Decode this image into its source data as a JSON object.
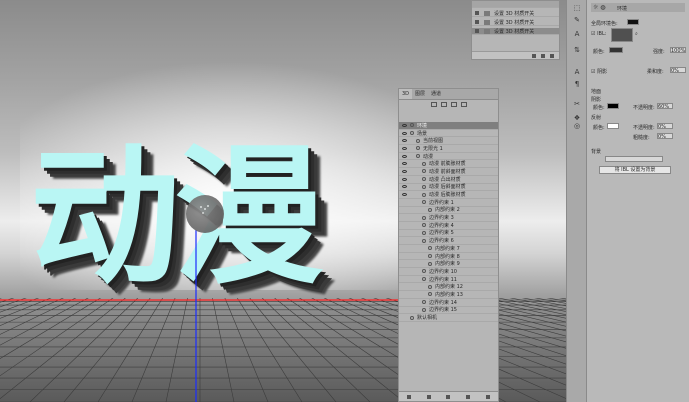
{
  "canvas": {
    "big_text": "动漫",
    "colors": {
      "text": "#b9f6f4",
      "extrusion": "#2e2e2e",
      "red_axis": "#ff2020",
      "blue_axis": "#1a2cff"
    }
  },
  "history_panel": {
    "items": [
      {
        "label": "设置 3D 材质开关",
        "selected": false
      },
      {
        "label": "设置 3D 材质开关",
        "selected": false
      },
      {
        "label": "设置 3D 材质开关",
        "selected": true
      }
    ]
  },
  "layers_panel": {
    "tabs": [
      "3D",
      "图层",
      "通道"
    ],
    "active_tab": "3D",
    "rows": [
      {
        "label": "环境",
        "indent": 0,
        "eye": true,
        "highlight": true
      },
      {
        "label": "场景",
        "indent": 0,
        "eye": true
      },
      {
        "label": "当前视图",
        "indent": 1,
        "eye": true
      },
      {
        "label": "无限光 1",
        "indent": 1,
        "eye": true
      },
      {
        "label": "动漫",
        "indent": 1,
        "eye": true
      },
      {
        "label": "动漫 前膨胀材质",
        "indent": 2,
        "eye": true
      },
      {
        "label": "动漫 前斜面材质",
        "indent": 2,
        "eye": true
      },
      {
        "label": "动漫 凸出材质",
        "indent": 2,
        "eye": true
      },
      {
        "label": "动漫 后斜面材质",
        "indent": 2,
        "eye": true
      },
      {
        "label": "动漫 后膨胀材质",
        "indent": 2,
        "eye": true
      },
      {
        "label": "边界约束 1",
        "indent": 2,
        "eye": false
      },
      {
        "label": "内部约束 2",
        "indent": 3,
        "eye": false
      },
      {
        "label": "边界约束 3",
        "indent": 2,
        "eye": false
      },
      {
        "label": "边界约束 4",
        "indent": 2,
        "eye": false
      },
      {
        "label": "边界约束 5",
        "indent": 2,
        "eye": false
      },
      {
        "label": "边界约束 6",
        "indent": 2,
        "eye": false
      },
      {
        "label": "内部约束 7",
        "indent": 3,
        "eye": false
      },
      {
        "label": "内部约束 8",
        "indent": 3,
        "eye": false
      },
      {
        "label": "内部约束 9",
        "indent": 3,
        "eye": false
      },
      {
        "label": "边界约束 10",
        "indent": 2,
        "eye": false
      },
      {
        "label": "边界约束 11",
        "indent": 2,
        "eye": false
      },
      {
        "label": "内部约束 12",
        "indent": 3,
        "eye": false
      },
      {
        "label": "内部约束 13",
        "indent": 3,
        "eye": false
      },
      {
        "label": "边界约束 14",
        "indent": 2,
        "eye": false
      },
      {
        "label": "边界约束 15",
        "indent": 2,
        "eye": false
      },
      {
        "label": "默认相机",
        "indent": 0,
        "eye": false
      }
    ]
  },
  "properties_panel": {
    "header": "环境",
    "global_ambient": "全局环境色:",
    "ibl": "IBL:",
    "color_label": "颜色:",
    "intensity_label": "强度:",
    "intensity_value": "100%",
    "shadow_label": "阴影",
    "softness_label": "柔和度:",
    "softness_value": "0%",
    "ground_label": "地面",
    "shadow_sub": "阴影",
    "shadow_color_label": "颜色:",
    "opacity_label": "不透明度:",
    "opacity_value_1": "60%",
    "reflection_label": "反射",
    "reflection_color_label": "颜色:",
    "opacity_value_2": "0%",
    "roughness_label": "粗糙度:",
    "roughness_value": "0%",
    "background_label": "背景",
    "set_bg_button": "将 IBL 设置为背景"
  }
}
